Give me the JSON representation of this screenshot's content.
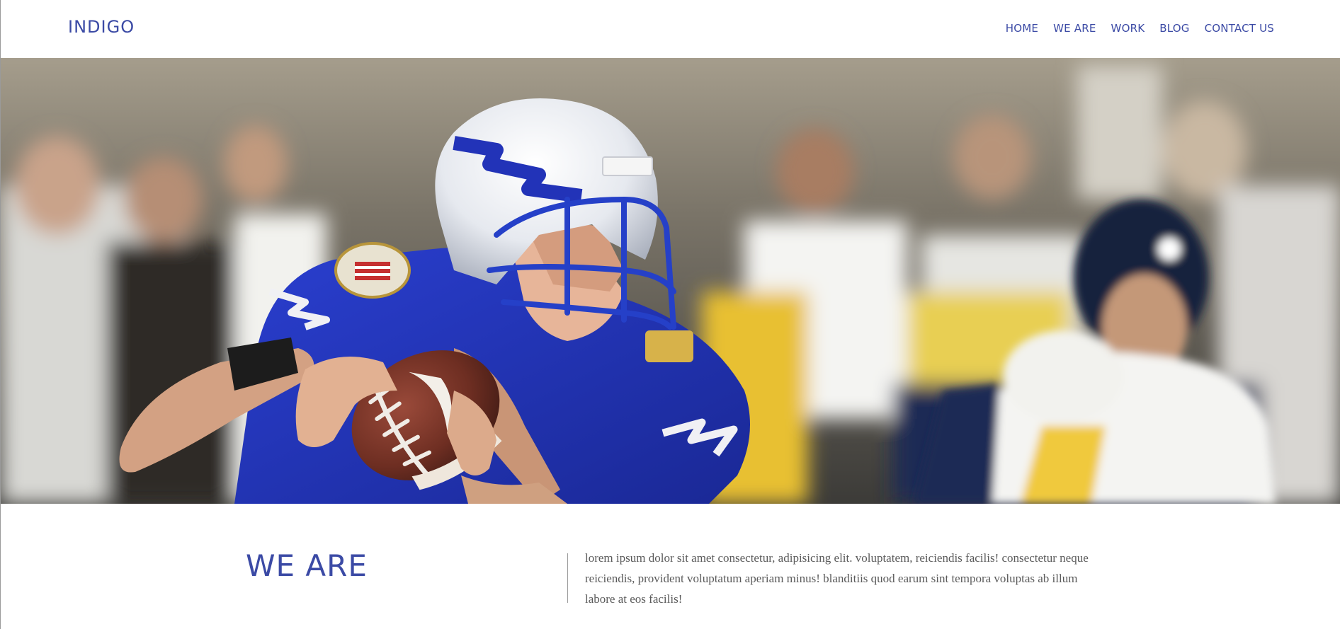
{
  "header": {
    "logo": "INDIGO",
    "nav": [
      {
        "label": "HOME"
      },
      {
        "label": "WE ARE"
      },
      {
        "label": "WORK"
      },
      {
        "label": "BLOG"
      },
      {
        "label": "CONTACT US"
      }
    ]
  },
  "hero": {
    "image": "american-football-quarterback-photo",
    "colors": {
      "jersey": "#2233b8",
      "helmet": "#e9ecf2",
      "ball": "#6e2e22"
    }
  },
  "about": {
    "title": "WE ARE",
    "text": "lorem ipsum dolor sit amet consectetur, adipisicing elit. voluptatem, reiciendis facilis! consectetur neque reiciendis, provident voluptatum aperiam minus! blanditiis quod earum sint tempora voluptas ab illum labore at eos facilis!"
  },
  "colors": {
    "accent": "#3b4aa5",
    "body_text": "#5a5a5a",
    "background": "#ffffff"
  }
}
